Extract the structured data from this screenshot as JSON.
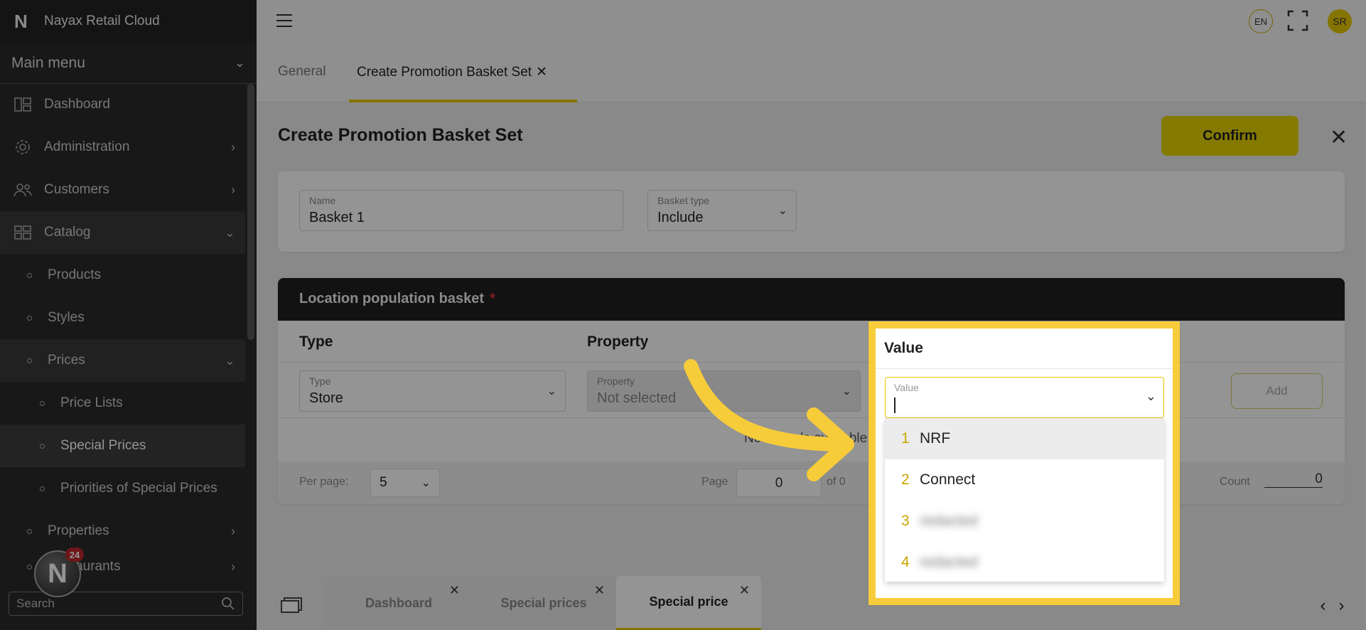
{
  "app": {
    "logo": "N",
    "name": "Nayax Retail Cloud"
  },
  "sidebar": {
    "menu_title": "Main menu",
    "items": [
      {
        "label": "Dashboard",
        "icon": "dashboard-icon"
      },
      {
        "label": "Administration",
        "icon": "gear-icon"
      },
      {
        "label": "Customers",
        "icon": "users-icon"
      },
      {
        "label": "Catalog",
        "icon": "catalog-icon"
      },
      {
        "label": "Products"
      },
      {
        "label": "Styles"
      },
      {
        "label": "Prices"
      },
      {
        "label": "Price Lists"
      },
      {
        "label": "Special Prices"
      },
      {
        "label": "Priorities of Special Prices"
      },
      {
        "label": "Properties"
      },
      {
        "label": "Restaurants"
      }
    ],
    "search_placeholder": "Search",
    "avatar_badge": "24",
    "avatar_letter": "N"
  },
  "header": {
    "lang": "EN",
    "user_initials": "SR"
  },
  "tabs": {
    "general": "General",
    "create": "Create Promotion Basket Set"
  },
  "page": {
    "title": "Create Promotion Basket Set",
    "confirm_label": "Confirm",
    "name_label": "Name",
    "name_value": "Basket 1",
    "basket_type_label": "Basket type",
    "basket_type_value": "Include"
  },
  "location_basket": {
    "title": "Location population basket",
    "required_mark": "*",
    "col_type": "Type",
    "col_property": "Property",
    "col_value": "Value",
    "type_label": "Type",
    "type_value": "Store",
    "property_label": "Property",
    "property_value": "Not selected",
    "add_label": "Add",
    "no_records": "No records available",
    "per_page_label": "Per page:",
    "per_page_value": "5",
    "page_label": "Page",
    "page_value": "0",
    "of_label": "of 0",
    "count_label": "Count",
    "count_value": "0"
  },
  "value_dropdown": {
    "header": "Value",
    "field_label": "Value",
    "options": [
      {
        "num": "1",
        "label": "NRF"
      },
      {
        "num": "2",
        "label": "Connect"
      },
      {
        "num": "3",
        "label": "redacted"
      },
      {
        "num": "4",
        "label": "redacted"
      }
    ]
  },
  "bottom_tabs": [
    {
      "label": "Dashboard"
    },
    {
      "label": "Special prices"
    },
    {
      "label": "Special price"
    }
  ],
  "colors": {
    "accent": "#e6c800",
    "highlight": "#f7cc3a",
    "sidebar": "#2a2a2a"
  }
}
